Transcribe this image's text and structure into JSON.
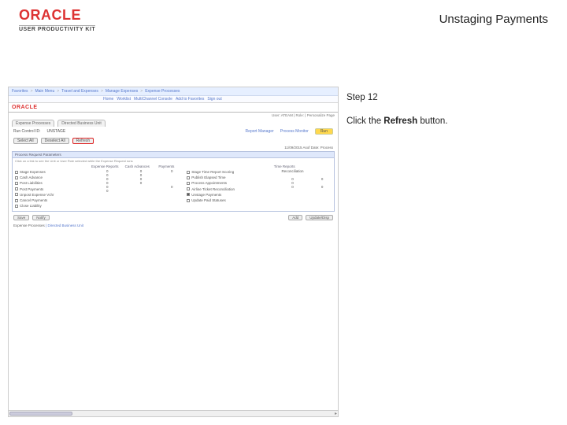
{
  "header": {
    "brand": "ORACLE",
    "brand_sub": "USER PRODUCTIVITY KIT",
    "title": "Unstaging Payments"
  },
  "instruction": {
    "step": "Step 12",
    "text_before": "Click the ",
    "bold": "Refresh",
    "text_after": " button."
  },
  "app": {
    "nav": {
      "items": [
        "Favorites",
        "Main Menu",
        "Travel and Expenses",
        "Manage Expenses",
        "Expense Processes"
      ],
      "right": [
        "Home",
        "Worklist",
        "MultiChannel Console",
        "Add to Favorites",
        "Sign out"
      ]
    },
    "brand": "ORACLE",
    "userline": "User: ATEAM  |  Role: | Personalize Page",
    "subtabs": [
      "Expense Processes",
      "Directed Business Unit"
    ],
    "run": {
      "label": "Run Control ID:",
      "value": "UNSTAGE",
      "report": "Report Manager",
      "process": "Process Monitor",
      "run_btn": "Run"
    },
    "btnbar": [
      "Select All",
      "Deselect All",
      "Refresh"
    ],
    "panel": {
      "title": "Process Request Parameters",
      "hint": "Click on a link to see the Unit or User Role selected while the Expense Request runs",
      "datelabel": "11/09/2015 Asof Date: Process",
      "cols": {
        "c1": {
          "head": "",
          "rows": [
            "Stage Expenses",
            "Cash Advance",
            "Post Liabilities",
            "Post Payments",
            "Unpost Expense Vchr",
            "Cancel Payments",
            "Close Liability"
          ]
        },
        "c2": {
          "head": "Expense Reports",
          "vals": [
            "0",
            "0",
            "0",
            "0",
            "0",
            "0",
            ""
          ]
        },
        "c3": {
          "head": "Cash Advances",
          "vals": [
            "0",
            "",
            "0",
            "0",
            "",
            "0",
            ""
          ]
        },
        "c4": {
          "head": "Payments",
          "vals": [
            "0",
            "",
            "",
            "",
            "0",
            "",
            ""
          ]
        },
        "c5": {
          "head": "",
          "rows": [
            "Stage Time Report Scoring",
            "Publish Elapsed Time",
            "Process Appointments",
            "Airline Ticket Reconciliation",
            "Unstage Payments",
            "Update Paid Statuses"
          ]
        },
        "c6": {
          "head": "Time Reports",
          "vals": [
            "",
            "Reconciliation",
            "",
            "0",
            "0",
            "0"
          ]
        },
        "c7": {
          "head": "",
          "vals": [
            "",
            "",
            "0",
            "",
            "0",
            ""
          ]
        }
      }
    },
    "bottom": {
      "save": "Save",
      "notify": "Notify",
      "add": "Add",
      "update": "Update/Disp"
    },
    "footer": {
      "tab": "Expense Processes",
      "link": "Directed Business Unit"
    }
  }
}
